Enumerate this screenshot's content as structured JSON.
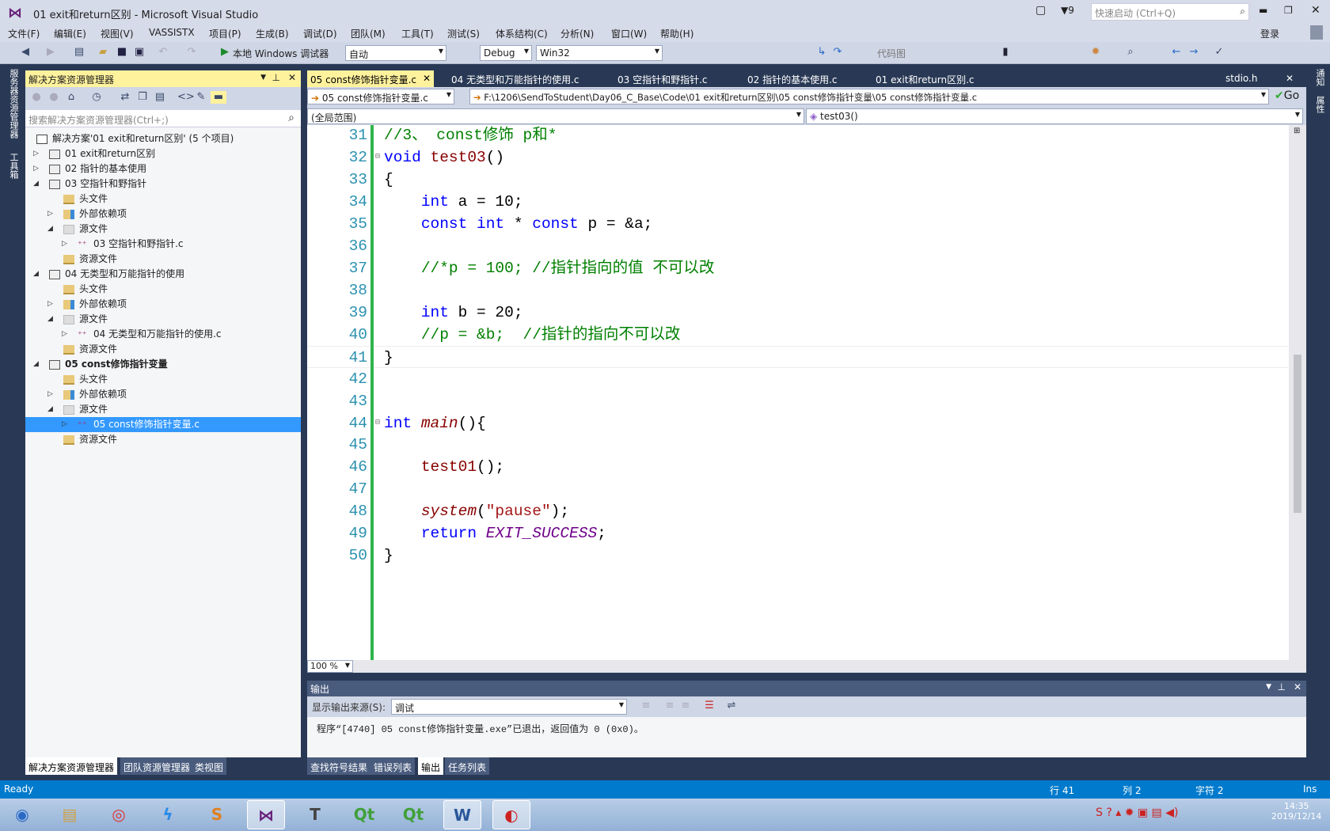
{
  "window": {
    "title": "01 exit和return区别 - Microsoft Visual Studio",
    "notif_count": "9",
    "quick_launch_placeholder": "快速启动 (Ctrl+Q)",
    "login": "登录"
  },
  "menu": [
    "文件(F)",
    "编辑(E)",
    "视图(V)",
    "VASSISTX",
    "项目(P)",
    "生成(B)",
    "调试(D)",
    "团队(M)",
    "工具(T)",
    "测试(S)",
    "体系结构(C)",
    "分析(N)",
    "窗口(W)",
    "帮助(H)"
  ],
  "toolbar": {
    "run_label": "本地 Windows 调试器",
    "solution_config_auto": "自动",
    "config": "Debug",
    "platform": "Win32",
    "code_map": "代码图"
  },
  "left_strip": [
    "服务器资源管理器",
    "工具箱"
  ],
  "right_strip": [
    "通知",
    "属性"
  ],
  "solution_explorer": {
    "title": "解决方案资源管理器",
    "search_placeholder": "搜索解决方案资源管理器(Ctrl+;)",
    "items": [
      {
        "label": "解决方案'01 exit和return区别' (5 个项目)",
        "level": 0,
        "exp": "",
        "icon": "solution"
      },
      {
        "label": "01 exit和return区别",
        "level": 1,
        "exp": "collapsed",
        "icon": "project"
      },
      {
        "label": "02 指针的基本使用",
        "level": 1,
        "exp": "collapsed",
        "icon": "project"
      },
      {
        "label": "03 空指针和野指针",
        "level": 1,
        "exp": "expanded",
        "icon": "project"
      },
      {
        "label": "头文件",
        "level": 2,
        "exp": "",
        "icon": "folder"
      },
      {
        "label": "外部依赖项",
        "level": 2,
        "exp": "collapsed",
        "icon": "external"
      },
      {
        "label": "源文件",
        "level": 2,
        "exp": "expanded",
        "icon": "source"
      },
      {
        "label": "03 空指针和野指针.c",
        "level": 3,
        "exp": "collapsed",
        "icon": "cfile"
      },
      {
        "label": "资源文件",
        "level": 2,
        "exp": "",
        "icon": "folder"
      },
      {
        "label": "04 无类型和万能指针的使用",
        "level": 1,
        "exp": "expanded",
        "icon": "project"
      },
      {
        "label": "头文件",
        "level": 2,
        "exp": "",
        "icon": "folder"
      },
      {
        "label": "外部依赖项",
        "level": 2,
        "exp": "collapsed",
        "icon": "external"
      },
      {
        "label": "源文件",
        "level": 2,
        "exp": "expanded",
        "icon": "source"
      },
      {
        "label": "04 无类型和万能指针的使用.c",
        "level": 3,
        "exp": "collapsed",
        "icon": "cfile"
      },
      {
        "label": "资源文件",
        "level": 2,
        "exp": "",
        "icon": "folder"
      },
      {
        "label": "05 const修饰指针变量",
        "level": 1,
        "exp": "expanded",
        "icon": "project",
        "bold": true
      },
      {
        "label": "头文件",
        "level": 2,
        "exp": "",
        "icon": "folder"
      },
      {
        "label": "外部依赖项",
        "level": 2,
        "exp": "collapsed",
        "icon": "external"
      },
      {
        "label": "源文件",
        "level": 2,
        "exp": "expanded",
        "icon": "source"
      },
      {
        "label": "05 const修饰指针变量.c",
        "level": 3,
        "exp": "collapsed",
        "icon": "cfile",
        "selected": true
      },
      {
        "label": "资源文件",
        "level": 2,
        "exp": "",
        "icon": "folder"
      }
    ],
    "bottom_tabs": [
      "解决方案资源管理器",
      "团队资源管理器",
      "类视图"
    ]
  },
  "editor": {
    "tabs": [
      "05 const修饰指针变量.c",
      "04 无类型和万能指针的使用.c",
      "03 空指针和野指针.c",
      "02 指针的基本使用.c",
      "01 exit和return区别.c"
    ],
    "pinned_tab": "stdio.h",
    "nav_file": "05 const修饰指针变量.c",
    "nav_path": "F:\\1206\\SendToStudent\\Day06_C_Base\\Code\\01 exit和return区别\\05 const修饰指针变量\\05 const修饰指针变量.c",
    "go": "Go",
    "scope": "(全局范围)",
    "member": "test03()",
    "zoom": "100 %",
    "lines": [
      {
        "n": "31",
        "t": [
          [
            "//3、 const修饰 p和*",
            "cm"
          ]
        ]
      },
      {
        "n": "32",
        "fold": true,
        "t": [
          [
            "void",
            "kw"
          ],
          [
            " ",
            "pl"
          ],
          [
            "test03",
            "fn"
          ],
          [
            "()",
            "pl"
          ]
        ]
      },
      {
        "n": "33",
        "t": [
          [
            "{",
            "pl"
          ]
        ]
      },
      {
        "n": "34",
        "t": [
          [
            "    ",
            "pl"
          ],
          [
            "int",
            "kw"
          ],
          [
            " a = 10;",
            "pl"
          ]
        ]
      },
      {
        "n": "35",
        "t": [
          [
            "    ",
            "pl"
          ],
          [
            "const",
            "kw"
          ],
          [
            " ",
            "pl"
          ],
          [
            "int",
            "kw"
          ],
          [
            " * ",
            "pl"
          ],
          [
            "const",
            "kw"
          ],
          [
            " p = &a;",
            "pl"
          ]
        ]
      },
      {
        "n": "36",
        "t": []
      },
      {
        "n": "37",
        "t": [
          [
            "    ",
            "pl"
          ],
          [
            "//*p = 100; //指针指向的值 不可以改",
            "cm"
          ]
        ]
      },
      {
        "n": "38",
        "t": []
      },
      {
        "n": "39",
        "t": [
          [
            "    ",
            "pl"
          ],
          [
            "int",
            "kw"
          ],
          [
            " b = 20;",
            "pl"
          ]
        ]
      },
      {
        "n": "40",
        "t": [
          [
            "    ",
            "pl"
          ],
          [
            "//p = &b;  //指针的指向不可以改",
            "cm"
          ]
        ]
      },
      {
        "n": "41",
        "t": [
          [
            "}",
            "pl"
          ]
        ],
        "current": true
      },
      {
        "n": "42",
        "t": []
      },
      {
        "n": "43",
        "t": []
      },
      {
        "n": "44",
        "fold": true,
        "t": [
          [
            "int",
            "kw"
          ],
          [
            " ",
            "pl"
          ],
          [
            "main",
            "it"
          ],
          [
            "(){",
            "pl"
          ]
        ]
      },
      {
        "n": "45",
        "t": []
      },
      {
        "n": "46",
        "t": [
          [
            "    ",
            "pl"
          ],
          [
            "test01",
            "fn"
          ],
          [
            "();",
            "pl"
          ]
        ]
      },
      {
        "n": "47",
        "t": []
      },
      {
        "n": "48",
        "t": [
          [
            "    ",
            "pl"
          ],
          [
            "system",
            "it"
          ],
          [
            "(",
            "pl"
          ],
          [
            "\"pause\"",
            "str"
          ],
          [
            ");",
            "pl"
          ]
        ]
      },
      {
        "n": "49",
        "t": [
          [
            "    ",
            "pl"
          ],
          [
            "return",
            "kw"
          ],
          [
            " ",
            "pl"
          ],
          [
            "EXIT_SUCCESS",
            "mac"
          ],
          [
            ";",
            "pl"
          ]
        ]
      },
      {
        "n": "50",
        "t": [
          [
            "}",
            "pl"
          ]
        ]
      }
    ]
  },
  "output": {
    "title": "输出",
    "source_label": "显示输出来源(S):",
    "source_value": "调试",
    "text": "程序“[4740] 05 const修饰指针变量.exe”已退出，返回值为 0 (0x0)。",
    "bottom_tabs": [
      "查找符号结果",
      "错误列表",
      "输出",
      "任务列表"
    ],
    "active_tab": "输出"
  },
  "status": {
    "ready": "Ready",
    "line": "行 41",
    "col": "列 2",
    "char": "字符 2",
    "mode": "Ins"
  },
  "taskbar": {
    "apps": [
      "start",
      "explorer",
      "chrome",
      "thunder",
      "sublime",
      "visual-studio",
      "typora",
      "qt-creator",
      "qt-designer",
      "word",
      "remote"
    ],
    "time": "14:35",
    "date": "2019/12/14"
  },
  "colors": {
    "accent": "#007acc",
    "highlight": "#fff29d",
    "selection": "#3399ff",
    "keyword": "#0000ff",
    "comment": "#008000"
  }
}
